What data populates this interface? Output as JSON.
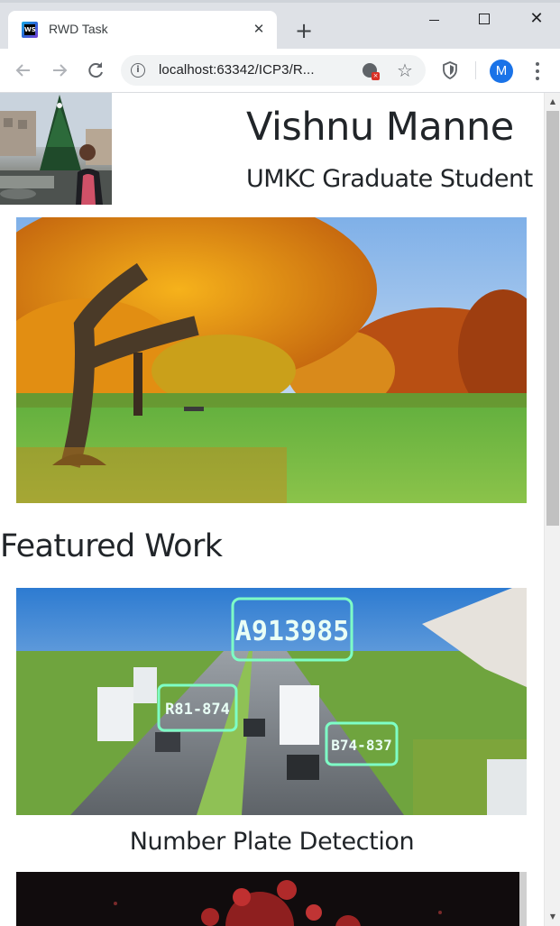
{
  "browser": {
    "tab_title": "RWD Task",
    "favicon_text": "WS",
    "tab_close": "✕",
    "new_tab": "+",
    "url": "localhost:63342/ICP3/R...",
    "profile_initial": "M",
    "window_close": "✕"
  },
  "header": {
    "name": "Vishnu Manne",
    "subtitle": "UMKC Graduate Student"
  },
  "featured": {
    "heading": "Featured Work",
    "items": [
      {
        "caption": "Number Plate Detection",
        "plates": [
          "A913985",
          "R81-874",
          "B74-837"
        ]
      }
    ]
  },
  "colors": {
    "accent": "#1a73e8",
    "text": "#212529",
    "chrome_bg": "#dee1e6"
  }
}
